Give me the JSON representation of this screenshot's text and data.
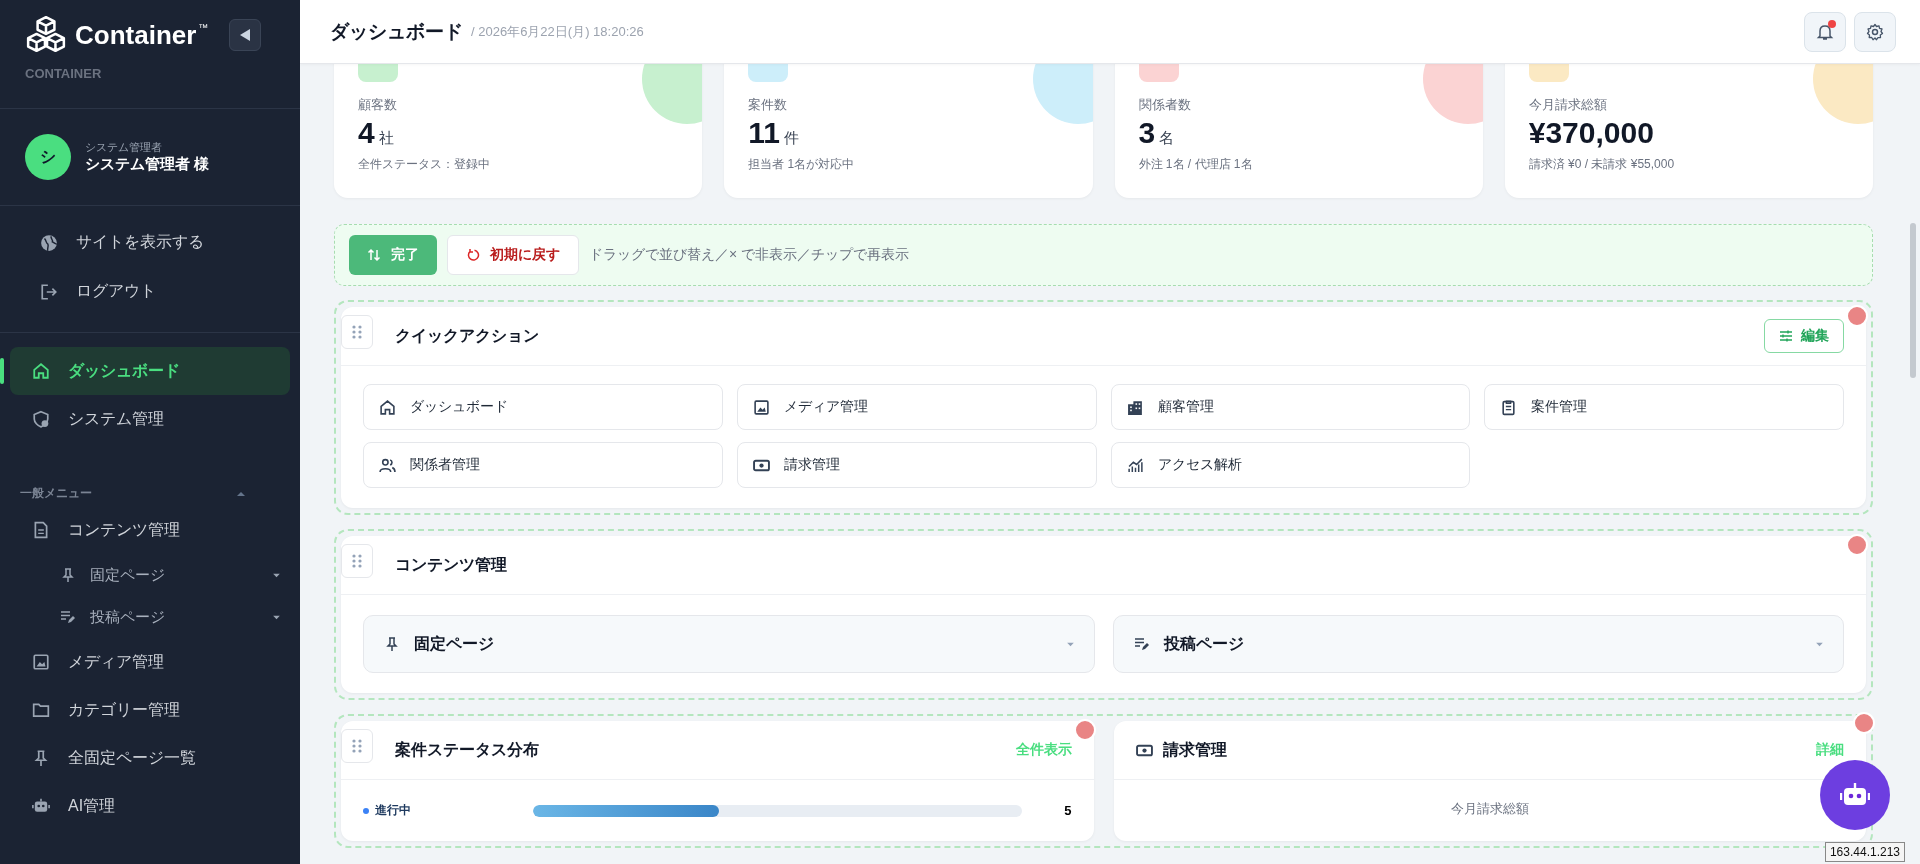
{
  "sidebar": {
    "logo": "Container",
    "trademark": "™",
    "subtitle": "CONTAINER",
    "user": {
      "avatar": "シ",
      "role": "システム管理者",
      "name": "システム管理者 様"
    },
    "links": [
      {
        "label": "サイトを表示する"
      },
      {
        "label": "ログアウト"
      }
    ],
    "nav": [
      {
        "label": "ダッシュボード",
        "selected": true
      },
      {
        "label": "システム管理",
        "selected": false
      }
    ],
    "section": {
      "title": "一般メニュー",
      "expanded": true,
      "items": [
        {
          "label": "コンテンツ管理",
          "children": [
            {
              "label": "固定ページ",
              "expanded": false
            },
            {
              "label": "投稿ページ",
              "expanded": false
            }
          ]
        },
        {
          "label": "メディア管理"
        },
        {
          "label": "カテゴリー管理"
        },
        {
          "label": "全固定ページ一覧"
        },
        {
          "label": "AI管理"
        }
      ]
    }
  },
  "header": {
    "title": "ダッシュボード",
    "datetime": "/ 2026年6月22日(月) 18:20:26",
    "notification": true
  },
  "stats": [
    {
      "label": "顧客数",
      "value": "4",
      "unit": "社",
      "note": "全件ステータス：登録中",
      "color": "#c7f0cf"
    },
    {
      "label": "案件数",
      "value": "11",
      "unit": "件",
      "note": "担当者 1名が対応中",
      "color": "#cdeefa"
    },
    {
      "label": "関係者数",
      "value": "3",
      "unit": "名",
      "note": "外注 1名 / 代理店 1名",
      "color": "#fbd3d3"
    },
    {
      "label": "今月請求総額",
      "value": "¥370,000",
      "note": "請求済 ¥0 / 未請求 ¥55,000",
      "color": "#fbe9c3"
    }
  ],
  "toolbar": {
    "buttons": [
      {
        "label": "完了",
        "kind": "primary"
      },
      {
        "label": "初期に戻す",
        "kind": "reset"
      }
    ],
    "hint": "ドラッグで並び替え／× で非表示／チップで再表示"
  },
  "quick_actions": {
    "title": "クイックアクション",
    "edit_label": "編集",
    "items": [
      {
        "label": "ダッシュボード"
      },
      {
        "label": "メディア管理"
      },
      {
        "label": "顧客管理"
      },
      {
        "label": "案件管理"
      },
      {
        "label": "関係者管理"
      },
      {
        "label": "請求管理"
      },
      {
        "label": "アクセス解析"
      }
    ]
  },
  "content_management": {
    "title": "コンテンツ管理",
    "items": [
      {
        "label": "固定ページ",
        "expanded": false
      },
      {
        "label": "投稿ページ",
        "expanded": false
      }
    ]
  },
  "status_distribution": {
    "title": "案件ステータス分布",
    "link": "全件表示",
    "rows": [
      {
        "label": "進行中",
        "level": 0.38,
        "count": "5"
      }
    ]
  },
  "billing": {
    "title": "請求管理",
    "link": "詳細",
    "total_label": "今月請求総額"
  },
  "ip_tooltip": "163.44.1.213"
}
